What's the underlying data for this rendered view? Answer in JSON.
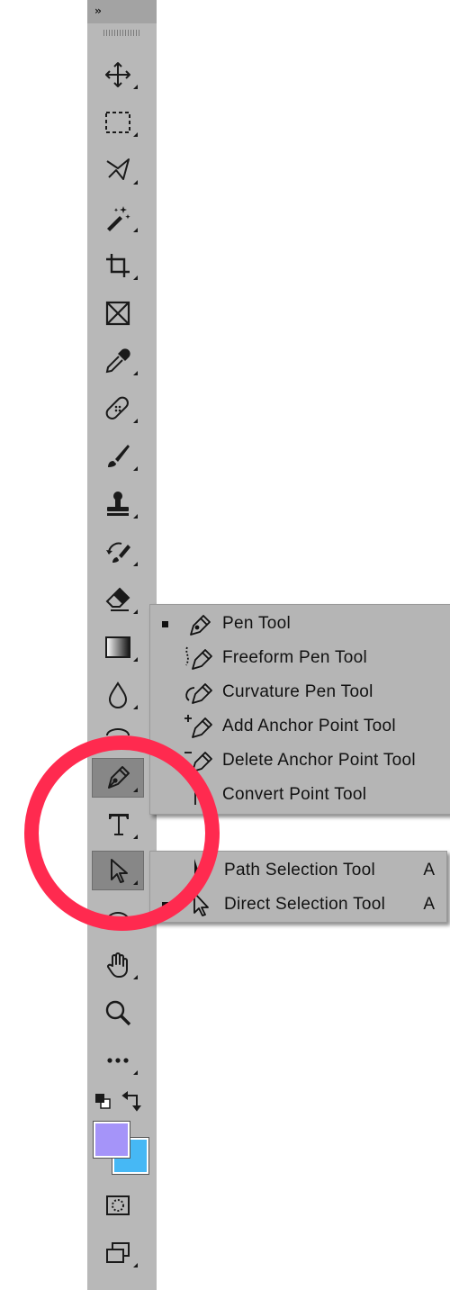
{
  "toolbar": {
    "collapse_label": "››",
    "tools": [
      {
        "name": "move-icon"
      },
      {
        "name": "rectangular-marquee-icon"
      },
      {
        "name": "lasso-icon"
      },
      {
        "name": "magic-wand-icon"
      },
      {
        "name": "crop-icon"
      },
      {
        "name": "frame-icon"
      },
      {
        "name": "eyedropper-icon"
      },
      {
        "name": "healing-brush-icon"
      },
      {
        "name": "brush-icon"
      },
      {
        "name": "clone-stamp-icon"
      },
      {
        "name": "history-brush-icon"
      },
      {
        "name": "eraser-icon"
      },
      {
        "name": "gradient-icon"
      },
      {
        "name": "blur-icon"
      },
      {
        "name": "dodge-icon"
      },
      {
        "name": "pen-icon",
        "active": true
      },
      {
        "name": "type-icon"
      },
      {
        "name": "direct-selection-icon",
        "active": true
      },
      {
        "name": "ellipse-icon"
      },
      {
        "name": "hand-icon"
      },
      {
        "name": "zoom-icon"
      },
      {
        "name": "more-tools-icon"
      },
      {
        "name": "quick-mask-icon"
      },
      {
        "name": "screen-mode-icon"
      }
    ],
    "foreground_color": "#a594f9",
    "background_color": "#46b8f5"
  },
  "pen_menu": {
    "items": [
      {
        "label": "Pen Tool",
        "selected": true,
        "icon": "pen-icon"
      },
      {
        "label": "Freeform Pen Tool",
        "selected": false,
        "icon": "freeform-pen-icon"
      },
      {
        "label": "Curvature Pen Tool",
        "selected": false,
        "icon": "curvature-pen-icon"
      },
      {
        "label": "Add Anchor Point Tool",
        "selected": false,
        "icon": "add-anchor-point-icon"
      },
      {
        "label": "Delete Anchor Point Tool",
        "selected": false,
        "icon": "delete-anchor-point-icon"
      },
      {
        "label": "Convert Point Tool",
        "selected": false,
        "icon": "convert-point-icon"
      }
    ]
  },
  "selection_menu": {
    "items": [
      {
        "label": "Path Selection Tool",
        "shortcut": "A",
        "selected": false,
        "icon": "path-selection-icon"
      },
      {
        "label": "Direct Selection Tool",
        "shortcut": "A",
        "selected": true,
        "icon": "direct-selection-icon"
      }
    ]
  },
  "colors": {
    "annotation_circle": "#ff2a4f",
    "toolbar_bg": "#b8b8b8",
    "menu_bg": "#b5b5b5"
  }
}
